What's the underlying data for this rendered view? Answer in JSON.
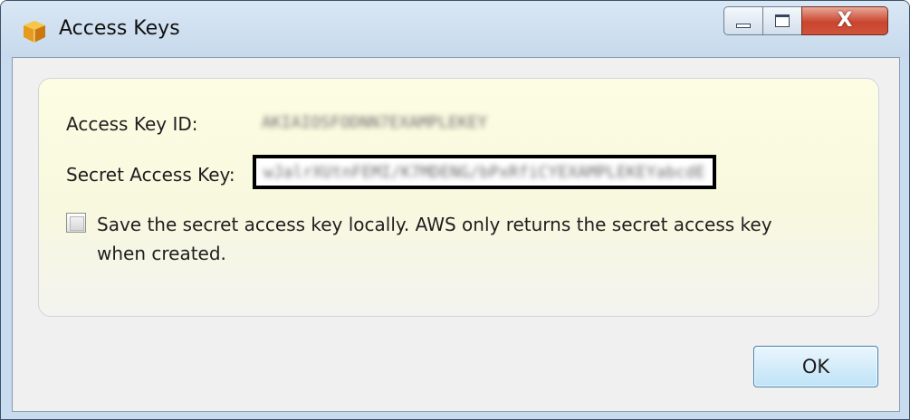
{
  "window": {
    "title": "Access Keys",
    "app_icon": "aws-cube-icon",
    "controls": {
      "minimize_icon": "minimize-icon",
      "maximize_icon": "maximize-icon",
      "close_icon": "close-icon",
      "close_glyph": "X"
    }
  },
  "form": {
    "access_key_id_label": "Access Key ID:",
    "access_key_id_value": "AKIAIOSFODNN7EXAMPLEKEY",
    "secret_key_label": "Secret Access Key:",
    "secret_key_value": "wJalrXUtnFEMI/K7MDENG/bPxRfiCYEXAMPLEKEYabcdEF12",
    "save_locally_checked": false,
    "save_locally_text": "Save the secret access key locally. AWS only returns the secret access key when created."
  },
  "buttons": {
    "ok_label": "OK"
  },
  "colors": {
    "panel_background": "#fdfde4",
    "ok_border": "#3c7fb1",
    "close_button": "#c9452e",
    "highlight_border": "#000000"
  }
}
